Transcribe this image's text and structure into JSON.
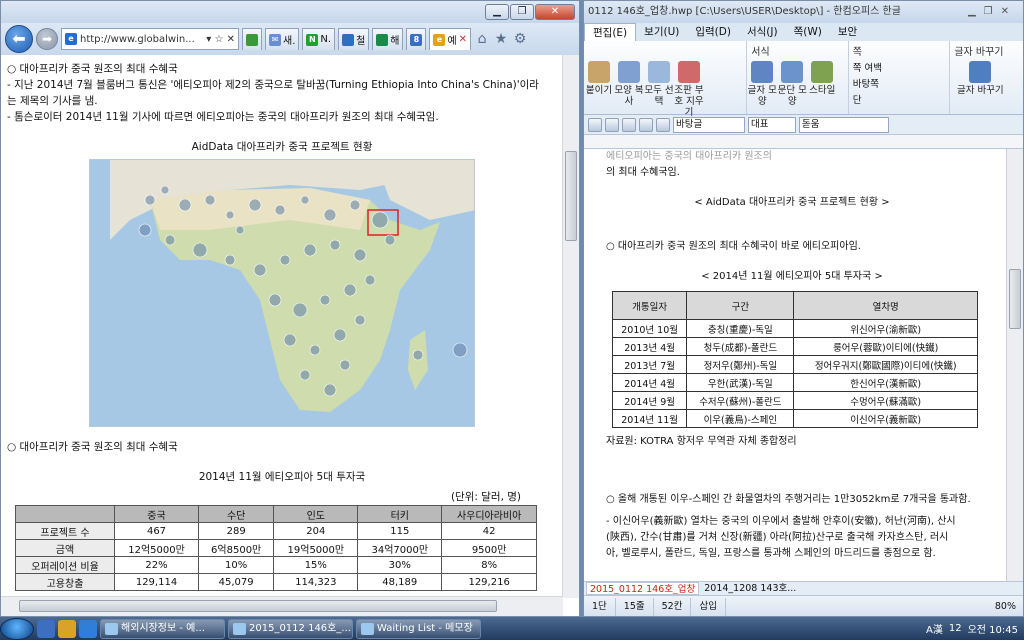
{
  "browser": {
    "title_buttons": [
      "▁",
      "❐",
      "✕"
    ],
    "address": "http://www.globalwin...",
    "address_controls": "▾ ☆ ✕",
    "tabs": [
      "새.",
      "N.",
      "철",
      "해",
      "8 예"
    ],
    "active_tab": "예",
    "content": {
      "lines": [
        "○ 대아프리카 중국 원조의 최대 수혜국",
        "- 지난 2014년 7월 블룸버그 통신은 '에티오피아 제2의 중국으로 탈바꿈(Turning Ethiopia Into China's China)'이라",
        "  는 제목의 기사를 냄.",
        "- 톰슨로이터 2014년 11월 기사에 따르면 에티오피아는 중국의 대아프리카 원조의 최대 수혜국임."
      ],
      "map_title": "AidData 대아프리카 중국 프로젝트 현황",
      "section2": "○ 대아프리카 중국 원조의 최대 수혜국",
      "table_title": "2014년 11월 에티오피아 5대 투자국",
      "unit": "(단위: 달러, 명)",
      "table": {
        "headers": [
          "",
          "중국",
          "수단",
          "인도",
          "터키",
          "사우디아라비아"
        ],
        "rows": [
          [
            "프로젝트 수",
            "467",
            "289",
            "204",
            "115",
            "42"
          ],
          [
            "금액",
            "12억5000만",
            "6억8500만",
            "19억5000만",
            "34억7000만",
            "9500만"
          ],
          [
            "오퍼레이션 비율",
            "22%",
            "10%",
            "15%",
            "30%",
            "8%"
          ],
          [
            "고용창출",
            "129,114",
            "45,079",
            "114,323",
            "48,189",
            "129,216"
          ]
        ]
      }
    }
  },
  "hancom": {
    "title": "0112 146호_업창.hwp [C:\\Users\\USER\\Desktop\\] - 한컴오피스 한글",
    "menus": [
      "편집(E)",
      "보기(U)",
      "입력(D)",
      "서식(J)",
      "쪽(W)",
      "보안"
    ],
    "ribbon": {
      "group_format": "서식",
      "group_page": "쪽",
      "group_char": "글자 바꾸기",
      "buttons": [
        {
          "label": "붙이기"
        },
        {
          "label": "모양 복사"
        },
        {
          "label": "모두 선택"
        },
        {
          "label": "조판 부호 지우기"
        },
        {
          "label": "글자 모양"
        },
        {
          "label": "문단 모양"
        },
        {
          "label": "스타일"
        },
        {
          "label": "쪽 여백"
        },
        {
          "label": "바탕쪽"
        },
        {
          "label": "단"
        },
        {
          "label": "글자 바꾸기"
        }
      ]
    },
    "toolbar": {
      "style": "바탕글",
      "font_kind": "대표",
      "font": "돋움"
    },
    "doc": {
      "top_line": "에티오피아는 중국의 대아프리카 원조의",
      "top_line2": "의 최대 수혜국임.",
      "map_caption": "< AidData 대아프리카 중국 프로젝트 현황 >",
      "para1": "○ 대아프리카 중국 원조의 최대 수혜국이 바로 에티오피아임.",
      "table_title": "< 2014년 11월 에티오피아 5대 투자국 >",
      "table": {
        "headers": [
          "개통일자",
          "구간",
          "열차명"
        ],
        "rows": [
          [
            "2010년 10월",
            "충칭(重慶)-독일",
            "위신어우(渝新歐)"
          ],
          [
            "2013년 4월",
            "청두(成都)-폴란드",
            "룽어우(蓉歐)이티에(快鐵)"
          ],
          [
            "2013년 7월",
            "정저우(鄭州)-독일",
            "정어우궈지(鄭歐國際)이티에(快鐵)"
          ],
          [
            "2014년 4월",
            "우한(武漢)-독일",
            "한신어우(漢新歐)"
          ],
          [
            "2014년 9월",
            "수저우(蘇州)-폴란드",
            "수멍어우(蘇滿歐)"
          ],
          [
            "2014년 11월",
            "이우(義烏)-스페인",
            "이신어우(義新歐)"
          ]
        ]
      },
      "source": "자료원: KOTRA 항저우 무역관 자체 종합정리",
      "para2": "○ 올해 개통된 이우-스페인 간 화물열차의 주행거리는 1만3052km로 7개국을 통과함.",
      "para3": "- 이신어우(義新歐) 열차는 중국의 이우에서 출발해 안후이(安徽), 허난(河南), 산시",
      "para4": "  (陝西), 간수(甘肅)를 거쳐 신장(新疆) 아라(阿拉)산구로 출국해 카자흐스탄, 러시",
      "para5": "  아, 벨로루시, 폴란드, 독일, 프랑스를 통과해 스페인의 마드리드를 종점으로 함."
    },
    "doc_tabs": [
      "2015_0112 146호_업창",
      "2014_1208 143호..."
    ],
    "status": {
      "page": "1단",
      "line": "15줄",
      "col": "52칸",
      "mode": "삽입",
      "zoom": "80%"
    }
  },
  "taskbar": {
    "buttons": [
      "해외시장정보 - 예...",
      "2015_0112 146호_...",
      "Waiting List - 메모장"
    ],
    "tray": {
      "ime": "A漢",
      "lang": "12",
      "clock": "오전 10:45"
    }
  }
}
